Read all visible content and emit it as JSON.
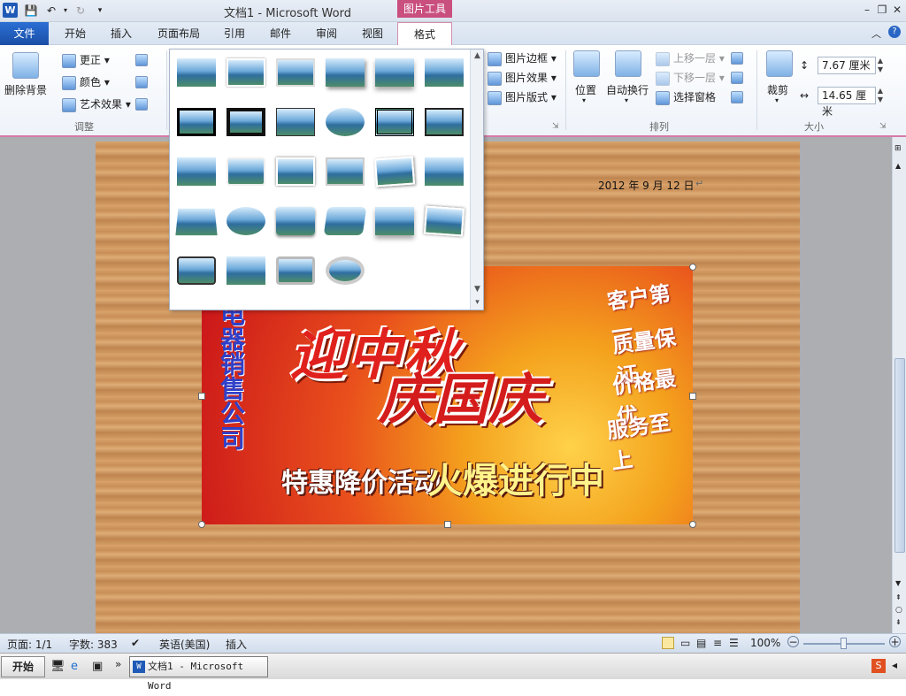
{
  "window": {
    "title": "文档1  -  Microsoft Word",
    "context_tab_group": "图片工具"
  },
  "tabs": [
    "文件",
    "开始",
    "插入",
    "页面布局",
    "引用",
    "邮件",
    "审阅",
    "视图",
    "格式"
  ],
  "ribbon": {
    "adjust": {
      "remove_bg": "删除背景",
      "corrections": "更正",
      "color": "颜色",
      "artistic": "艺术效果",
      "group_label": "调整"
    },
    "picture_styles": {
      "border": "图片边框",
      "effects": "图片效果",
      "layout": "图片版式"
    },
    "arrange": {
      "position": "位置",
      "wrap": "自动换行",
      "bring_forward": "上移一层",
      "send_backward": "下移一层",
      "selection_pane": "选择窗格",
      "group_label": "排列"
    },
    "size": {
      "crop": "裁剪",
      "height": "7.67 厘米",
      "width": "14.65 厘米",
      "group_label": "大小"
    }
  },
  "document": {
    "date": "2012 年 9 月 12 日",
    "poster": {
      "title_line1": "迎中秋",
      "title_line2": "庆国庆",
      "company": "电器销售公司",
      "slogans": [
        "客户第一",
        "质量保证",
        "价格最优",
        "服务至上"
      ],
      "sale_text": "特惠降价活动",
      "hot_text": "火爆进行中"
    }
  },
  "status": {
    "page": "页面: 1/1",
    "words": "字数: 383",
    "language": "英语(美国)",
    "mode": "插入",
    "zoom": "100%"
  },
  "taskbar": {
    "start": "开始",
    "word_task": "文档1 - Microsoft Word"
  }
}
